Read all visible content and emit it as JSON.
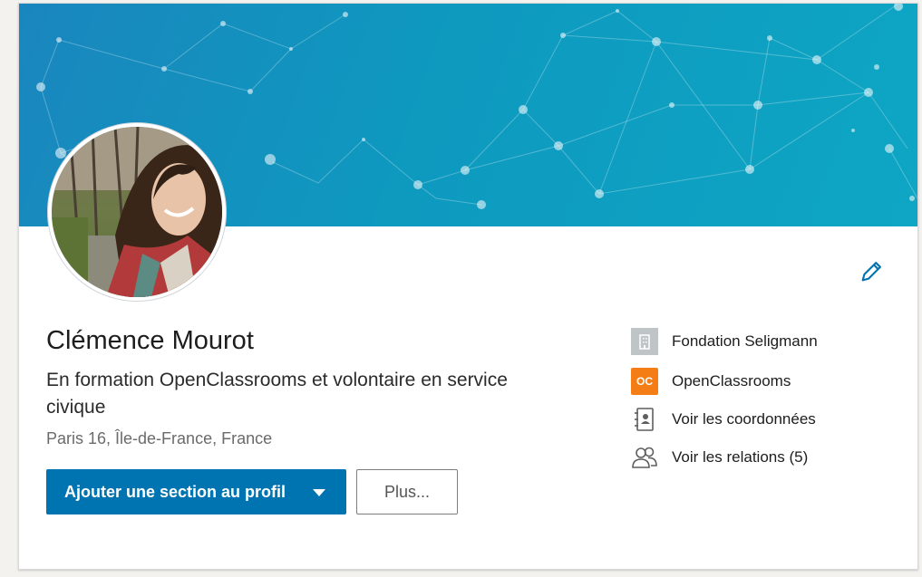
{
  "profile": {
    "name": "Clémence Mourot",
    "headline": "En formation OpenClassrooms et volontaire en service civique",
    "location": "Paris 16, Île-de-France, France"
  },
  "actions": {
    "add_section_label": "Ajouter une section au profil",
    "more_label": "Plus..."
  },
  "sidebar": {
    "items": [
      {
        "label": "Fondation Seligmann",
        "icon": "company-building-icon"
      },
      {
        "label": "OpenClassrooms",
        "icon": "openclassrooms-logo",
        "logo_text": "OC"
      },
      {
        "label": "Voir les coordonnées",
        "icon": "contact-card-icon"
      },
      {
        "label": "Voir les relations (5)",
        "icon": "people-icon"
      }
    ]
  },
  "icons": {
    "edit": "pencil-icon",
    "dropdown": "caret-down-icon"
  },
  "colors": {
    "primary": "#0073b1",
    "banner_start": "#1a86be",
    "banner_end": "#0ea6c4",
    "oc_orange": "#f57d16"
  }
}
